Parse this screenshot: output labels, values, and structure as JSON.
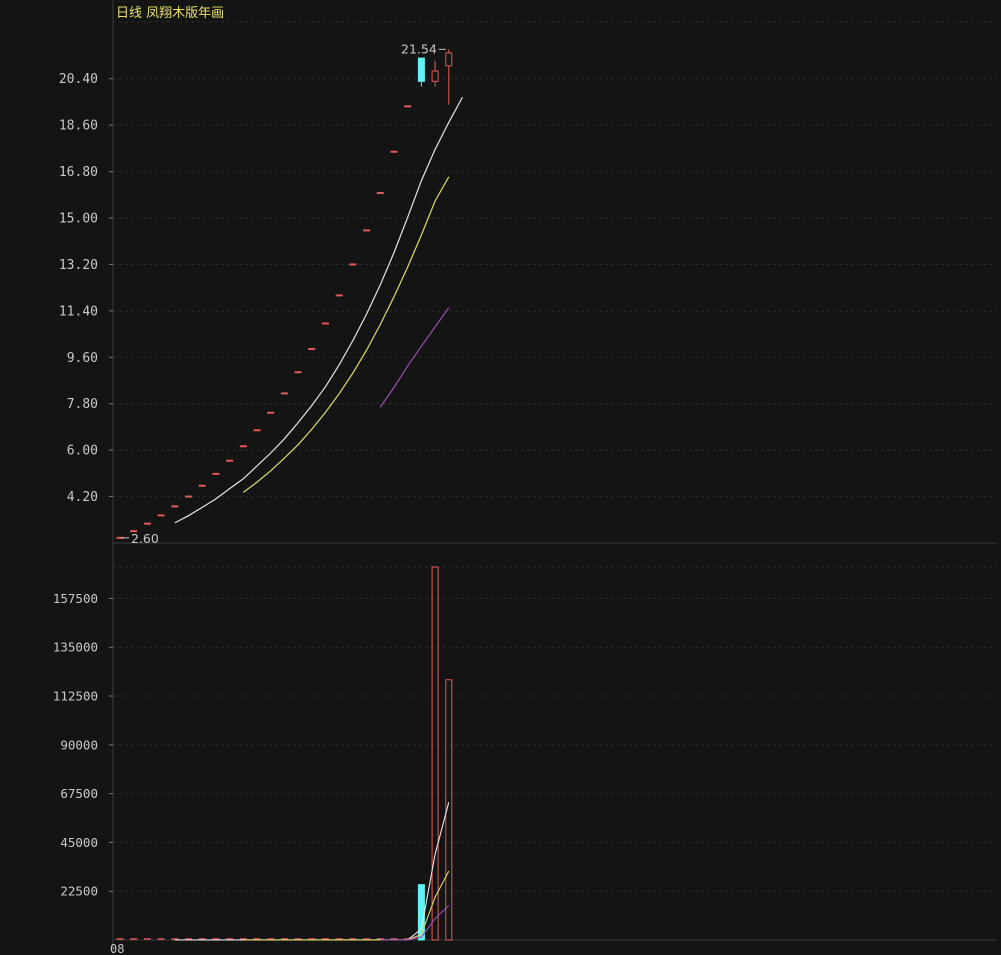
{
  "title": "日线 凤翔木版年画",
  "colors": {
    "background": "#141414",
    "grid": "#2a2a2a",
    "axis_text": "#c9c9c9",
    "up": "#e05a57",
    "down": "#5ff3f3",
    "ma5": "#e6e6e6",
    "ma10": "#dcdc6a",
    "ma20": "#9a4fb0"
  },
  "chart_data": [
    {
      "type": "candlestick",
      "title": "日线 凤翔木版年画",
      "ylim": [
        2.4,
        22.6
      ],
      "yticks": [
        "4.20",
        "6.00",
        "7.80",
        "9.60",
        "11.40",
        "13.20",
        "15.00",
        "16.80",
        "18.60",
        "20.40"
      ],
      "high_annotation": "21.54",
      "low_annotation": "2.60",
      "candles": [
        {
          "o": 2.6,
          "h": 2.6,
          "l": 2.6,
          "c": 2.6
        },
        {
          "o": 2.86,
          "h": 2.86,
          "l": 2.86,
          "c": 2.86
        },
        {
          "o": 3.15,
          "h": 3.15,
          "l": 3.15,
          "c": 3.15
        },
        {
          "o": 3.47,
          "h": 3.47,
          "l": 3.47,
          "c": 3.47
        },
        {
          "o": 3.82,
          "h": 3.82,
          "l": 3.82,
          "c": 3.82
        },
        {
          "o": 4.2,
          "h": 4.2,
          "l": 4.2,
          "c": 4.2
        },
        {
          "o": 4.62,
          "h": 4.62,
          "l": 4.62,
          "c": 4.62
        },
        {
          "o": 5.08,
          "h": 5.08,
          "l": 5.08,
          "c": 5.08
        },
        {
          "o": 5.59,
          "h": 5.59,
          "l": 5.59,
          "c": 5.59
        },
        {
          "o": 6.15,
          "h": 6.15,
          "l": 6.15,
          "c": 6.15
        },
        {
          "o": 6.77,
          "h": 6.77,
          "l": 6.77,
          "c": 6.77
        },
        {
          "o": 7.45,
          "h": 7.45,
          "l": 7.45,
          "c": 7.45
        },
        {
          "o": 8.2,
          "h": 8.2,
          "l": 8.2,
          "c": 8.2
        },
        {
          "o": 9.02,
          "h": 9.02,
          "l": 9.02,
          "c": 9.02
        },
        {
          "o": 9.92,
          "h": 9.92,
          "l": 9.92,
          "c": 9.92
        },
        {
          "o": 10.91,
          "h": 10.91,
          "l": 10.91,
          "c": 10.91
        },
        {
          "o": 12.0,
          "h": 12.0,
          "l": 12.0,
          "c": 12.0
        },
        {
          "o": 13.2,
          "h": 13.2,
          "l": 13.2,
          "c": 13.2
        },
        {
          "o": 14.52,
          "h": 14.52,
          "l": 14.52,
          "c": 14.52
        },
        {
          "o": 15.97,
          "h": 15.97,
          "l": 15.97,
          "c": 15.97
        },
        {
          "o": 17.57,
          "h": 17.57,
          "l": 17.57,
          "c": 17.57
        },
        {
          "o": 19.33,
          "h": 19.33,
          "l": 19.33,
          "c": 19.33
        },
        {
          "o": 21.2,
          "h": 21.2,
          "l": 20.1,
          "c": 20.3
        },
        {
          "o": 20.3,
          "h": 21.1,
          "l": 20.1,
          "c": 20.7
        },
        {
          "o": 20.9,
          "h": 21.54,
          "l": 19.4,
          "c": 21.4
        }
      ],
      "ma_series": [
        {
          "color": "#e6e6e6",
          "start": 4,
          "values": [
            3.18,
            3.46,
            3.78,
            4.11,
            4.51,
            4.89,
            5.39,
            5.89,
            6.44,
            7.07,
            7.73,
            8.46,
            9.31,
            10.25,
            11.28,
            12.41,
            13.66,
            15.03,
            16.45,
            17.66,
            18.71,
            19.69
          ]
        },
        {
          "color": "#dcdc6a",
          "start": 9,
          "values": [
            4.36,
            4.76,
            5.2,
            5.69,
            6.21,
            6.81,
            7.47,
            8.19,
            8.99,
            9.88,
            10.87,
            11.95,
            13.1,
            14.34,
            15.66,
            16.6
          ]
        },
        {
          "color": "#9a4fb0",
          "start": 19,
          "values": [
            7.67,
            8.43,
            9.27,
            10.03,
            10.78,
            11.52
          ]
        }
      ]
    },
    {
      "type": "bar",
      "title": "",
      "ylim": [
        0,
        172000
      ],
      "yticks": [
        "22500",
        "45000",
        "67500",
        "90000",
        "112500",
        "135000",
        "157500"
      ],
      "xticks": [
        "08"
      ],
      "volumes": [
        50,
        50,
        50,
        50,
        50,
        50,
        50,
        50,
        50,
        50,
        50,
        50,
        50,
        50,
        50,
        50,
        50,
        50,
        50,
        50,
        50,
        50,
        25500,
        172000,
        120000
      ],
      "up_flags": [
        1,
        1,
        1,
        1,
        1,
        1,
        1,
        1,
        1,
        1,
        1,
        1,
        1,
        1,
        1,
        1,
        1,
        1,
        1,
        1,
        1,
        1,
        0,
        1,
        1
      ],
      "ma_series": [
        {
          "color": "#e6e6e6",
          "start": 4,
          "values": [
            50,
            50,
            50,
            50,
            50,
            50,
            50,
            50,
            50,
            50,
            50,
            50,
            50,
            50,
            50,
            50,
            50,
            50,
            5140,
            39540,
            63540
          ]
        },
        {
          "color": "#dcdc6a",
          "start": 9,
          "values": [
            50,
            50,
            50,
            50,
            50,
            50,
            50,
            50,
            50,
            50,
            50,
            50,
            50,
            2595,
            19790,
            31790
          ]
        },
        {
          "color": "#9a4fb0",
          "start": 19,
          "values": [
            50,
            50,
            50,
            1322,
            9920,
            15920
          ]
        }
      ]
    }
  ]
}
